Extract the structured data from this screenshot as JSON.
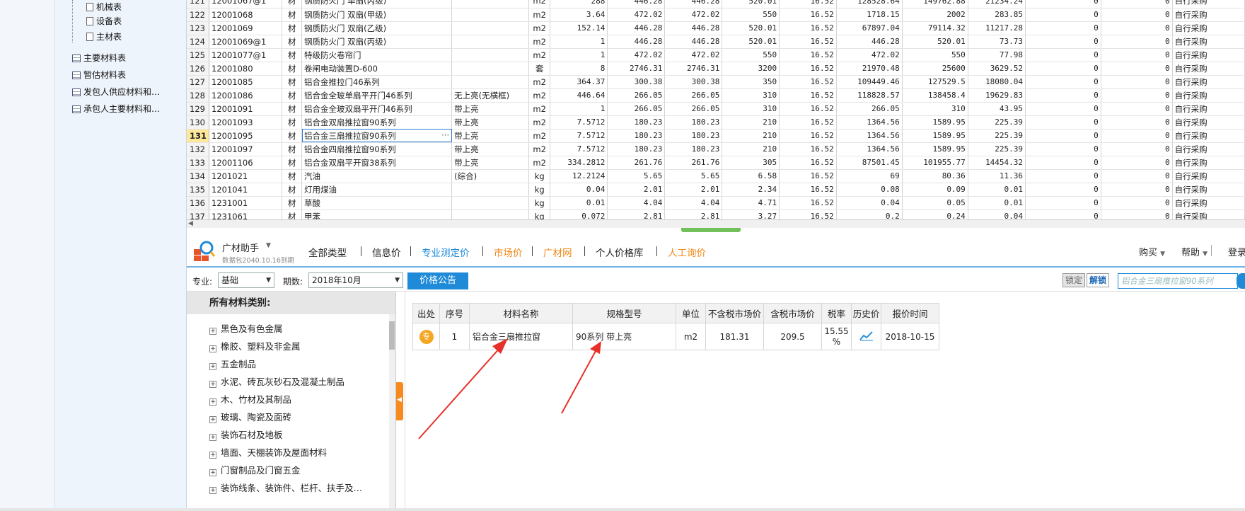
{
  "tree": {
    "items": [
      {
        "label": "机械表",
        "type": "doc"
      },
      {
        "label": "设备表",
        "type": "doc"
      },
      {
        "label": "主材表",
        "type": "doc"
      },
      {
        "label": "主要材料表",
        "type": "table"
      },
      {
        "label": "暂估材料表",
        "type": "table"
      },
      {
        "label": "发包人供应材料和…",
        "type": "table"
      },
      {
        "label": "承包人主要材料和…",
        "type": "table"
      }
    ]
  },
  "top_table": {
    "rows": [
      [
        "121",
        "12001067@1",
        "材",
        "钢质防火门 单扇(丙级)",
        "",
        "m2",
        "288",
        "446.28",
        "446.28",
        "520.01",
        "16.52",
        "128528.64",
        "149762.88",
        "21234.24",
        "0",
        "0",
        "自行采购"
      ],
      [
        "122",
        "12001068",
        "材",
        "钢质防火门 双扇(甲级)",
        "",
        "m2",
        "3.64",
        "472.02",
        "472.02",
        "550",
        "16.52",
        "1718.15",
        "2002",
        "283.85",
        "0",
        "0",
        "自行采购"
      ],
      [
        "123",
        "12001069",
        "材",
        "钢质防火门 双扇(乙级)",
        "",
        "m2",
        "152.14",
        "446.28",
        "446.28",
        "520.01",
        "16.52",
        "67897.04",
        "79114.32",
        "11217.28",
        "0",
        "0",
        "自行采购"
      ],
      [
        "124",
        "12001069@1",
        "材",
        "钢质防火门 双扇(丙级)",
        "",
        "m2",
        "1",
        "446.28",
        "446.28",
        "520.01",
        "16.52",
        "446.28",
        "520.01",
        "73.73",
        "0",
        "0",
        "自行采购"
      ],
      [
        "125",
        "12001077@1",
        "材",
        "特级防火卷帘门",
        "",
        "m2",
        "1",
        "472.02",
        "472.02",
        "550",
        "16.52",
        "472.02",
        "550",
        "77.98",
        "0",
        "0",
        "自行采购"
      ],
      [
        "126",
        "12001080",
        "材",
        "卷闸电动装置D-600",
        "",
        "套",
        "8",
        "2746.31",
        "2746.31",
        "3200",
        "16.52",
        "21970.48",
        "25600",
        "3629.52",
        "0",
        "0",
        "自行采购"
      ],
      [
        "127",
        "12001085",
        "材",
        "铝合金推拉门46系列",
        "",
        "m2",
        "364.37",
        "300.38",
        "300.38",
        "350",
        "16.52",
        "109449.46",
        "127529.5",
        "18080.04",
        "0",
        "0",
        "自行采购"
      ],
      [
        "128",
        "12001086",
        "材",
        "铝合金全玻单扇平开门46系列",
        "无上亮(无横框)",
        "m2",
        "446.64",
        "266.05",
        "266.05",
        "310",
        "16.52",
        "118828.57",
        "138458.4",
        "19629.83",
        "0",
        "0",
        "自行采购"
      ],
      [
        "129",
        "12001091",
        "材",
        "铝合金全玻双扇平开门46系列",
        "带上亮",
        "m2",
        "1",
        "266.05",
        "266.05",
        "310",
        "16.52",
        "266.05",
        "310",
        "43.95",
        "0",
        "0",
        "自行采购"
      ],
      [
        "130",
        "12001093",
        "材",
        "铝合金双扇推拉窗90系列",
        "带上亮",
        "m2",
        "7.5712",
        "180.23",
        "180.23",
        "210",
        "16.52",
        "1364.56",
        "1589.95",
        "225.39",
        "0",
        "0",
        "自行采购"
      ],
      [
        "131",
        "12001095",
        "材",
        "铝合金三扇推拉窗90系列",
        "带上亮",
        "m2",
        "7.5712",
        "180.23",
        "180.23",
        "210",
        "16.52",
        "1364.56",
        "1589.95",
        "225.39",
        "0",
        "0",
        "自行采购"
      ],
      [
        "132",
        "12001097",
        "材",
        "铝合金四扇推拉窗90系列",
        "带上亮",
        "m2",
        "7.5712",
        "180.23",
        "180.23",
        "210",
        "16.52",
        "1364.56",
        "1589.95",
        "225.39",
        "0",
        "0",
        "自行采购"
      ],
      [
        "133",
        "12001106",
        "材",
        "铝合金双扇平开窗38系列",
        "带上亮",
        "m2",
        "334.2812",
        "261.76",
        "261.76",
        "305",
        "16.52",
        "87501.45",
        "101955.77",
        "14454.32",
        "0",
        "0",
        "自行采购"
      ],
      [
        "134",
        "1201021",
        "材",
        "汽油",
        "(综合)",
        "kg",
        "12.2124",
        "5.65",
        "5.65",
        "6.58",
        "16.52",
        "69",
        "80.36",
        "11.36",
        "0",
        "0",
        "自行采购"
      ],
      [
        "135",
        "1201041",
        "材",
        "灯用煤油",
        "",
        "kg",
        "0.04",
        "2.01",
        "2.01",
        "2.34",
        "16.52",
        "0.08",
        "0.09",
        "0.01",
        "0",
        "0",
        "自行采购"
      ],
      [
        "136",
        "1231001",
        "材",
        "草酸",
        "",
        "kg",
        "0.01",
        "4.04",
        "4.04",
        "4.71",
        "16.52",
        "0.04",
        "0.05",
        "0.01",
        "0",
        "0",
        "自行采购"
      ],
      [
        "137",
        "1231061",
        "材",
        "甲苯",
        "",
        "kg",
        "0.072",
        "2.81",
        "2.81",
        "3.27",
        "16.52",
        "0.2",
        "0.24",
        "0.04",
        "0",
        "0",
        "自行采购"
      ]
    ],
    "active_row": "131",
    "ellipsis": "···"
  },
  "assistant": {
    "title": "广材助手",
    "subtitle": "数据包2040.10.16到期",
    "tabs": [
      {
        "label": "全部类型",
        "style": "normal"
      },
      {
        "label": "信息价",
        "style": "normal"
      },
      {
        "label": "专业测定价",
        "style": "active"
      },
      {
        "label": "市场价",
        "style": "orange"
      },
      {
        "label": "广材网",
        "style": "orange"
      },
      {
        "label": "个人价格库",
        "style": "normal"
      },
      {
        "label": "人工询价",
        "style": "orange"
      }
    ],
    "right_menu": {
      "buy": "购买",
      "help": "帮助",
      "login": "登录"
    }
  },
  "filter": {
    "specialty_label": "专业:",
    "specialty_value": "基础",
    "period_label": "期数:",
    "period_value": "2018年10月",
    "notice_button": "价格公告",
    "lock": "锁定",
    "unlock": "解锁",
    "search_value": "铝合金三扇推拉窗90系列"
  },
  "categories": {
    "header": "所有材料类别:",
    "items": [
      "黑色及有色金属",
      "橡胶、塑料及非金属",
      "五金制品",
      "水泥、砖瓦灰砂石及混凝土制品",
      "木、竹材及其制品",
      "玻璃、陶瓷及面砖",
      "装饰石材及地板",
      "墙面、天棚装饰及屋面材料",
      "门窗制品及门窗五金",
      "装饰线条、装饰件、栏杆、扶手及…"
    ]
  },
  "result": {
    "headers": [
      "出处",
      "序号",
      "材料名称",
      "规格型号",
      "单位",
      "不含税市场价",
      "含税市场价",
      "税率",
      "历史价",
      "报价时间"
    ],
    "rows": [
      {
        "source_badge": "专",
        "index": "1",
        "name": "铝合金三扇推拉窗",
        "spec": "90系列 带上亮",
        "unit": "m2",
        "price_ex_tax": "181.31",
        "price_inc_tax": "209.5",
        "tax_rate": "15.55 %",
        "date": "2018-10-15"
      }
    ]
  },
  "colors": {
    "accent": "#1e8ad8",
    "orange": "#f08a18",
    "arrow": "#e8302a",
    "badge": "#f5a623"
  }
}
